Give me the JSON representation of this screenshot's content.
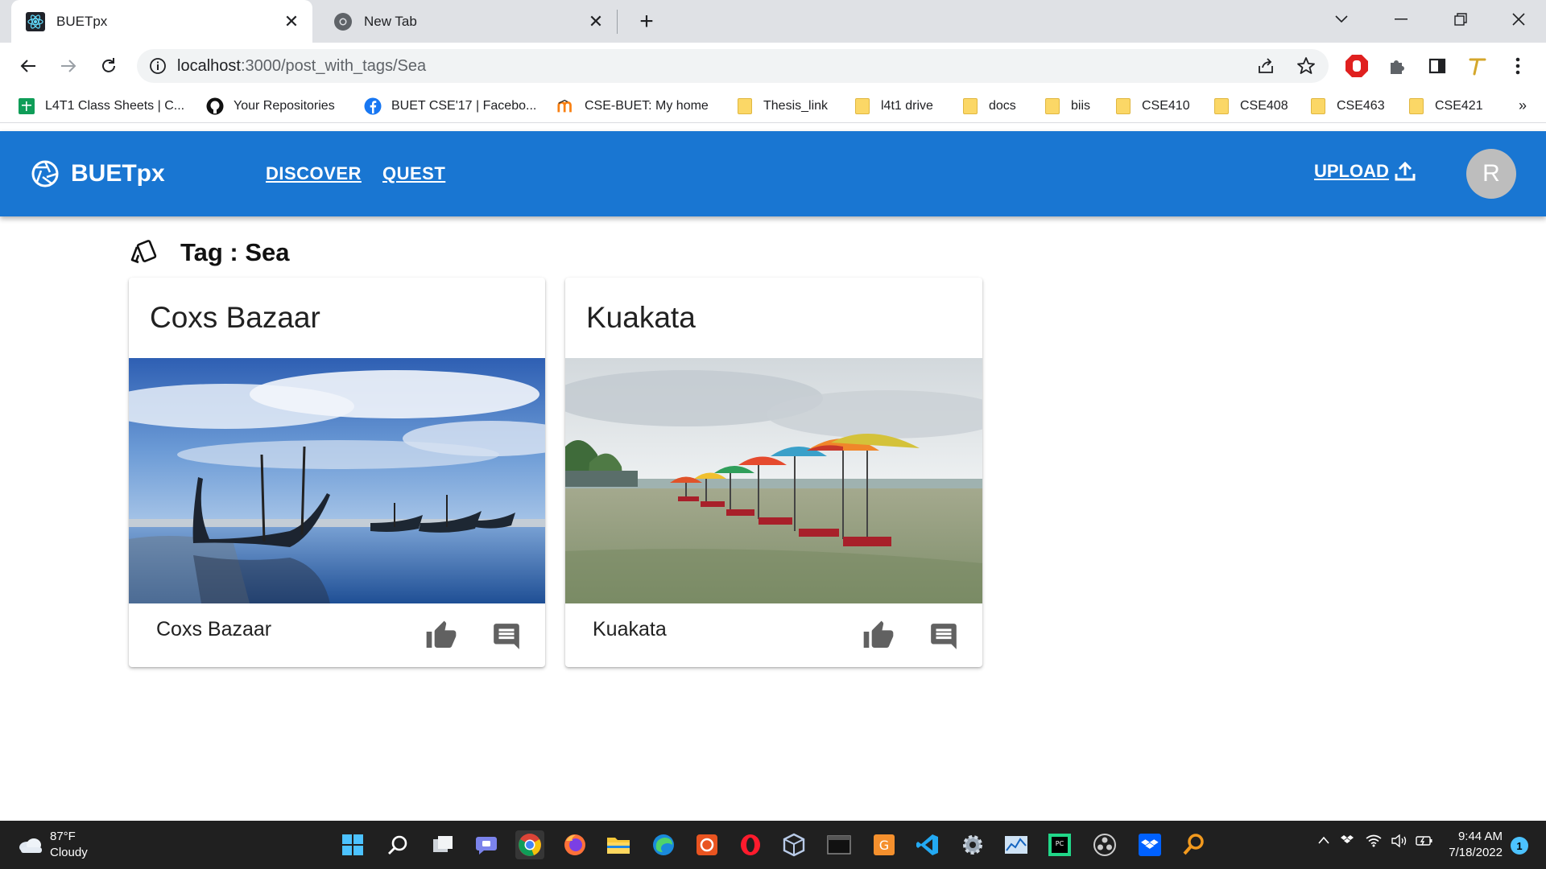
{
  "browser": {
    "tabs": [
      {
        "title": "BUETpx",
        "icon": "react-icon",
        "active": true
      },
      {
        "title": "New Tab",
        "icon": "chrome-icon",
        "active": false
      }
    ],
    "url": {
      "host": "localhost",
      "path": ":3000/post_with_tags/Sea"
    },
    "bookmarks": [
      {
        "label": "L4T1 Class Sheets | C...",
        "icon": "sheets-icon"
      },
      {
        "label": "Your Repositories",
        "icon": "github-icon"
      },
      {
        "label": "BUET CSE'17 | Facebo...",
        "icon": "facebook-icon"
      },
      {
        "label": "CSE-BUET: My home",
        "icon": "moodle-icon"
      },
      {
        "label": "Thesis_link",
        "icon": "folder-icon"
      },
      {
        "label": "l4t1 drive",
        "icon": "folder-icon"
      },
      {
        "label": "docs",
        "icon": "folder-icon"
      },
      {
        "label": "biis",
        "icon": "folder-icon"
      },
      {
        "label": "CSE410",
        "icon": "folder-icon"
      },
      {
        "label": "CSE408",
        "icon": "folder-icon"
      },
      {
        "label": "CSE463",
        "icon": "folder-icon"
      },
      {
        "label": "CSE421",
        "icon": "folder-icon"
      }
    ],
    "bookmarks_more": "»"
  },
  "app": {
    "brand": "BUETpx",
    "nav": {
      "discover": "DISCOVER",
      "quest": "QUEST"
    },
    "upload_label": "UPLOAD",
    "avatar_initial": "R"
  },
  "page": {
    "tag_label": "Tag : Sea",
    "posts": [
      {
        "title": "Coxs Bazaar",
        "caption": "Coxs Bazaar",
        "image": "boats-on-beach"
      },
      {
        "title": "Kuakata",
        "caption": "Kuakata",
        "image": "beach-umbrellas"
      }
    ]
  },
  "taskbar": {
    "weather_temp": "87°F",
    "weather_desc": "Cloudy",
    "time": "9:44 AM",
    "date": "7/18/2022",
    "notifications": "1"
  },
  "colors": {
    "appbar": "#1976d2",
    "avatar": "#bdbdbd",
    "taskbar": "#202020"
  }
}
